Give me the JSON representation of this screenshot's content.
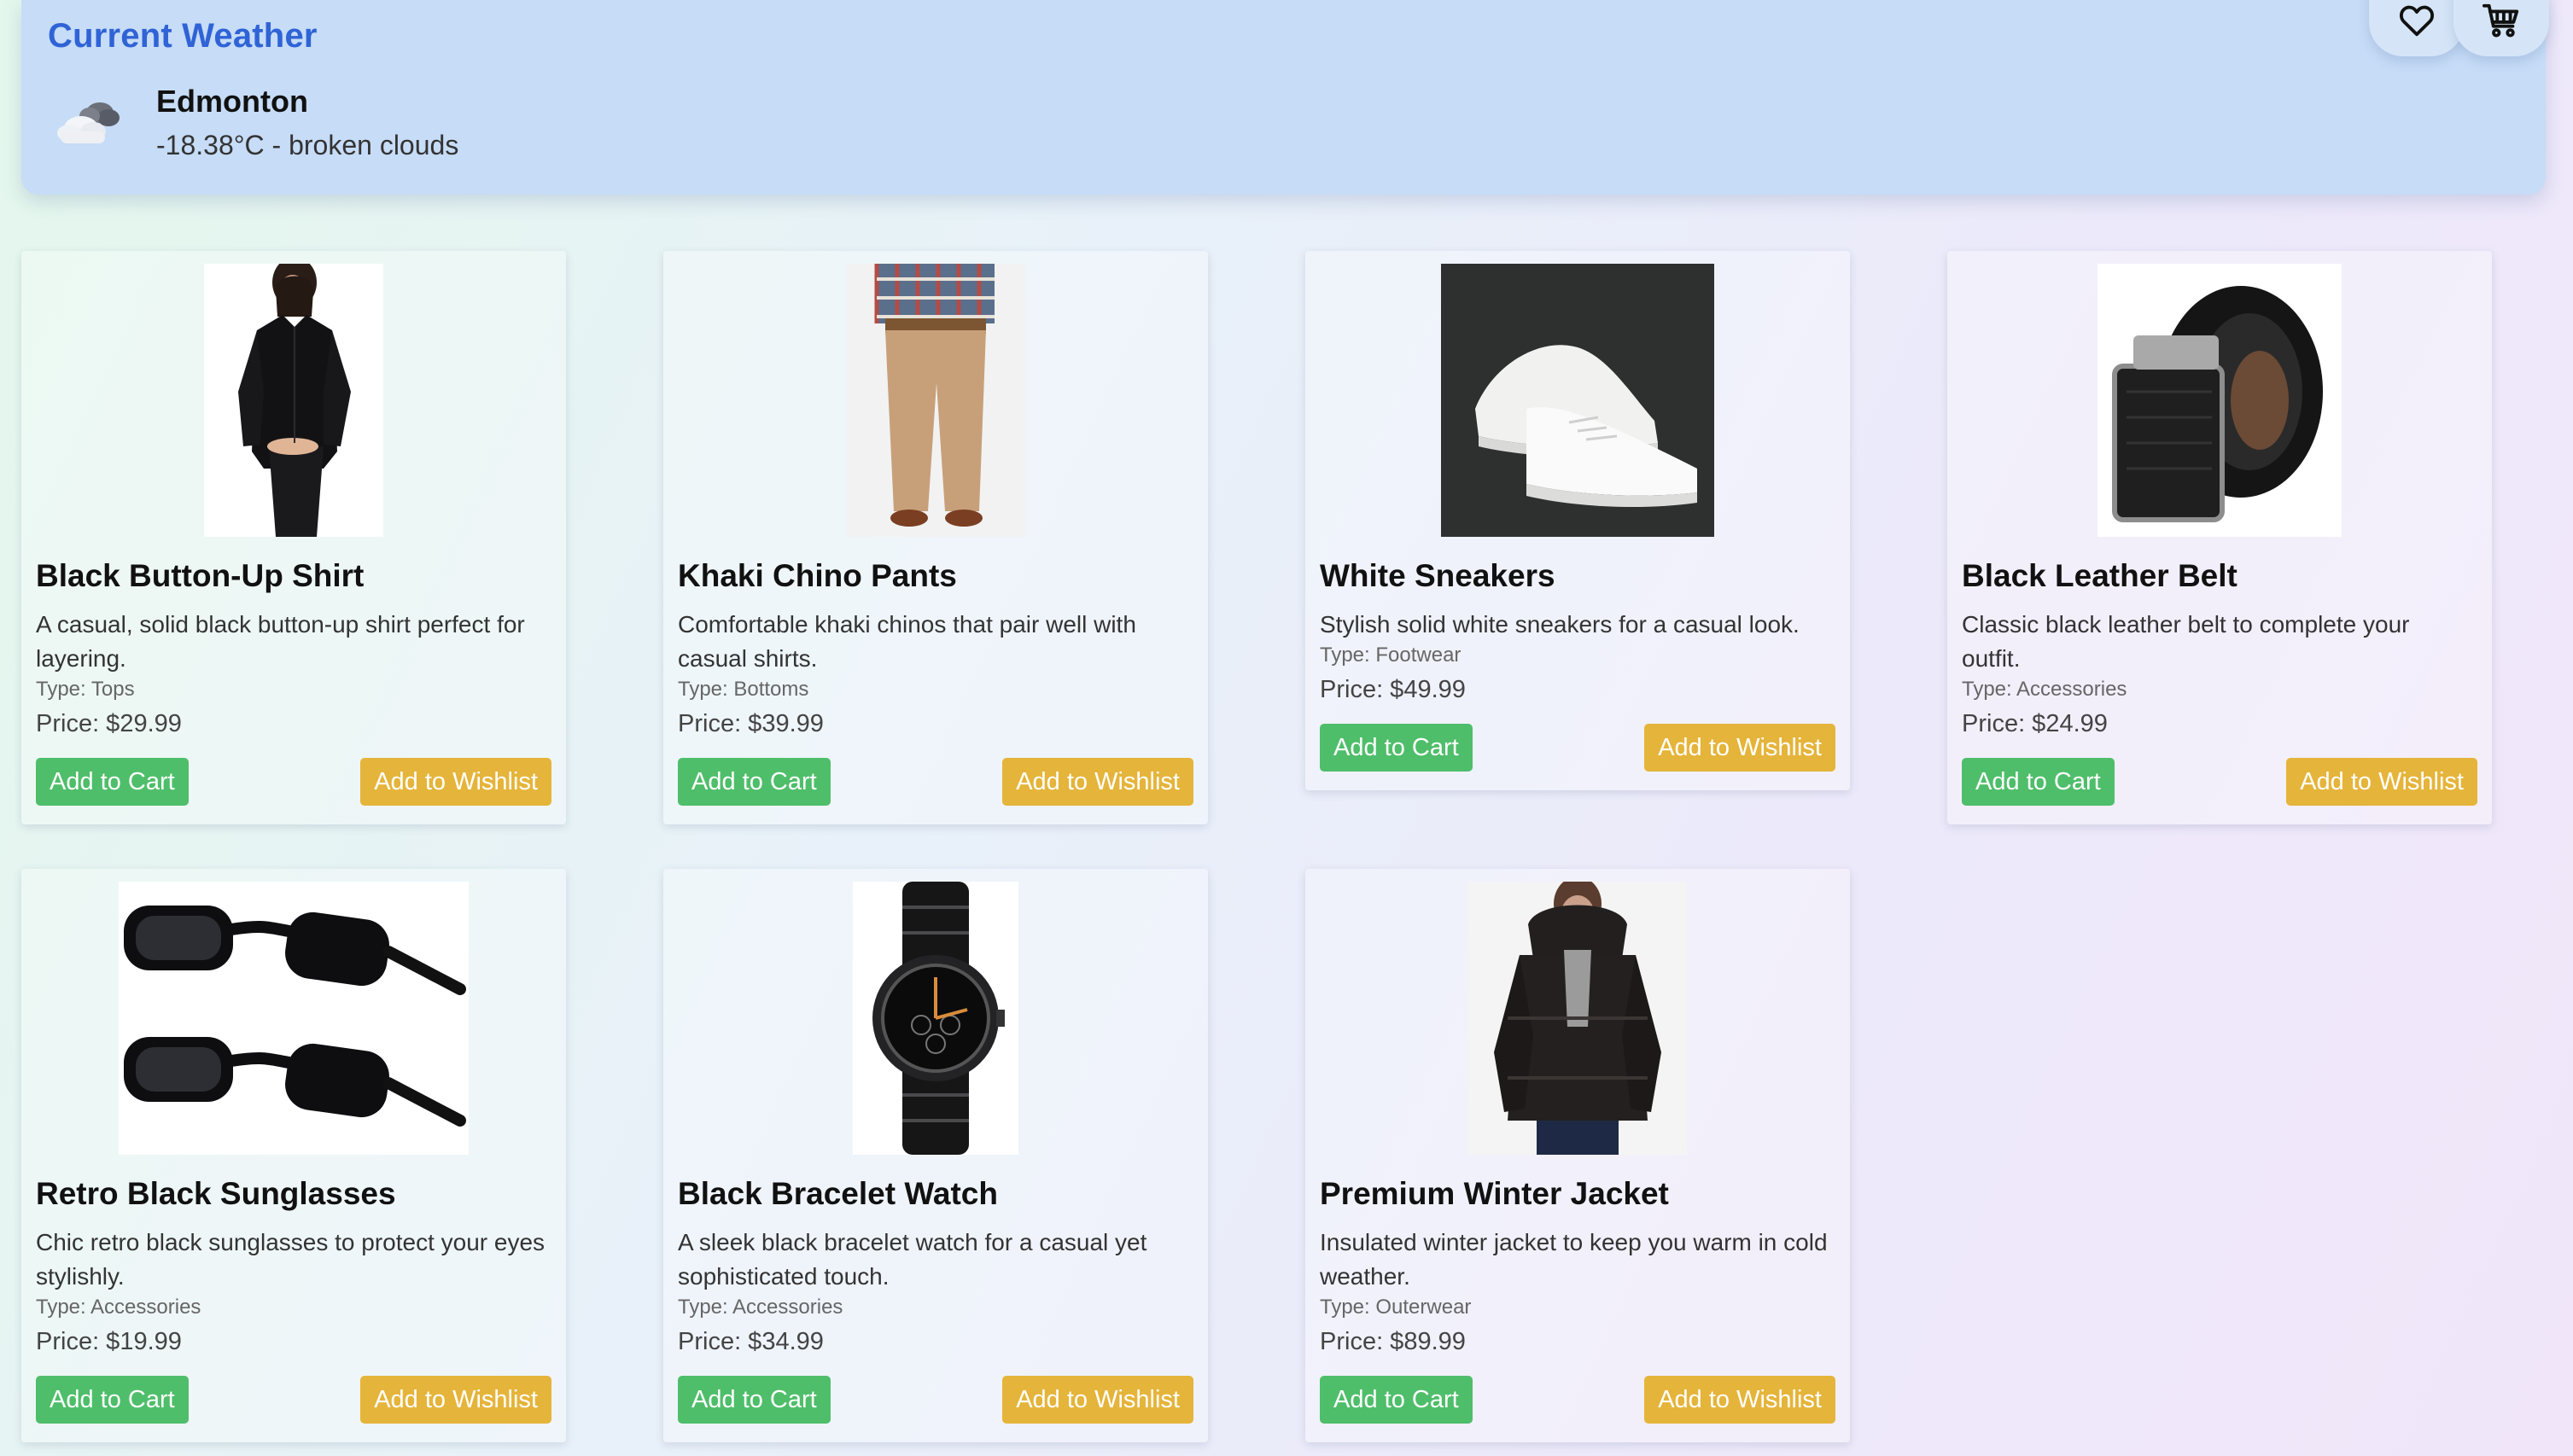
{
  "weather": {
    "title": "Current Weather",
    "city": "Edmonton",
    "description": "-18.38°C - broken clouds",
    "icon": "broken-clouds-icon"
  },
  "nav": {
    "wishlist_icon": "heart-icon",
    "cart_icon": "shopping-cart-icon"
  },
  "colors": {
    "title_blue": "#2f63d6",
    "header_bg": "#c6dcf7",
    "cart_button": "#4fbe6a",
    "wishlist_button": "#e5b43a"
  },
  "products": [
    {
      "name": "Black Button-Up Shirt",
      "description": "A casual, solid black button-up shirt perfect for layering.",
      "type": "Type: Tops",
      "price": "Price: $29.99",
      "cart_label": "Add to Cart",
      "wishlist_label": "Add to Wishlist",
      "image": "black-shirt-image"
    },
    {
      "name": "Khaki Chino Pants",
      "description": "Comfortable khaki chinos that pair well with casual shirts.",
      "type": "Type: Bottoms",
      "price": "Price: $39.99",
      "cart_label": "Add to Cart",
      "wishlist_label": "Add to Wishlist",
      "image": "khaki-pants-image"
    },
    {
      "name": "White Sneakers",
      "description": "Stylish solid white sneakers for a casual look.",
      "type": "Type: Footwear",
      "price": "Price: $49.99",
      "cart_label": "Add to Cart",
      "wishlist_label": "Add to Wishlist",
      "image": "white-sneakers-image"
    },
    {
      "name": "Black Leather Belt",
      "description": "Classic black leather belt to complete your outfit.",
      "type": "Type: Accessories",
      "price": "Price: $24.99",
      "cart_label": "Add to Cart",
      "wishlist_label": "Add to Wishlist",
      "image": "leather-belt-image"
    },
    {
      "name": "Retro Black Sunglasses",
      "description": "Chic retro black sunglasses to protect your eyes stylishly.",
      "type": "Type: Accessories",
      "price": "Price: $19.99",
      "cart_label": "Add to Cart",
      "wishlist_label": "Add to Wishlist",
      "image": "sunglasses-image"
    },
    {
      "name": "Black Bracelet Watch",
      "description": "A sleek black bracelet watch for a casual yet sophisticated touch.",
      "type": "Type: Accessories",
      "price": "Price: $34.99",
      "cart_label": "Add to Cart",
      "wishlist_label": "Add to Wishlist",
      "image": "bracelet-watch-image"
    },
    {
      "name": "Premium Winter Jacket",
      "description": "Insulated winter jacket to keep you warm in cold weather.",
      "type": "Type: Outerwear",
      "price": "Price: $89.99",
      "cart_label": "Add to Cart",
      "wishlist_label": "Add to Wishlist",
      "image": "winter-jacket-image"
    }
  ]
}
